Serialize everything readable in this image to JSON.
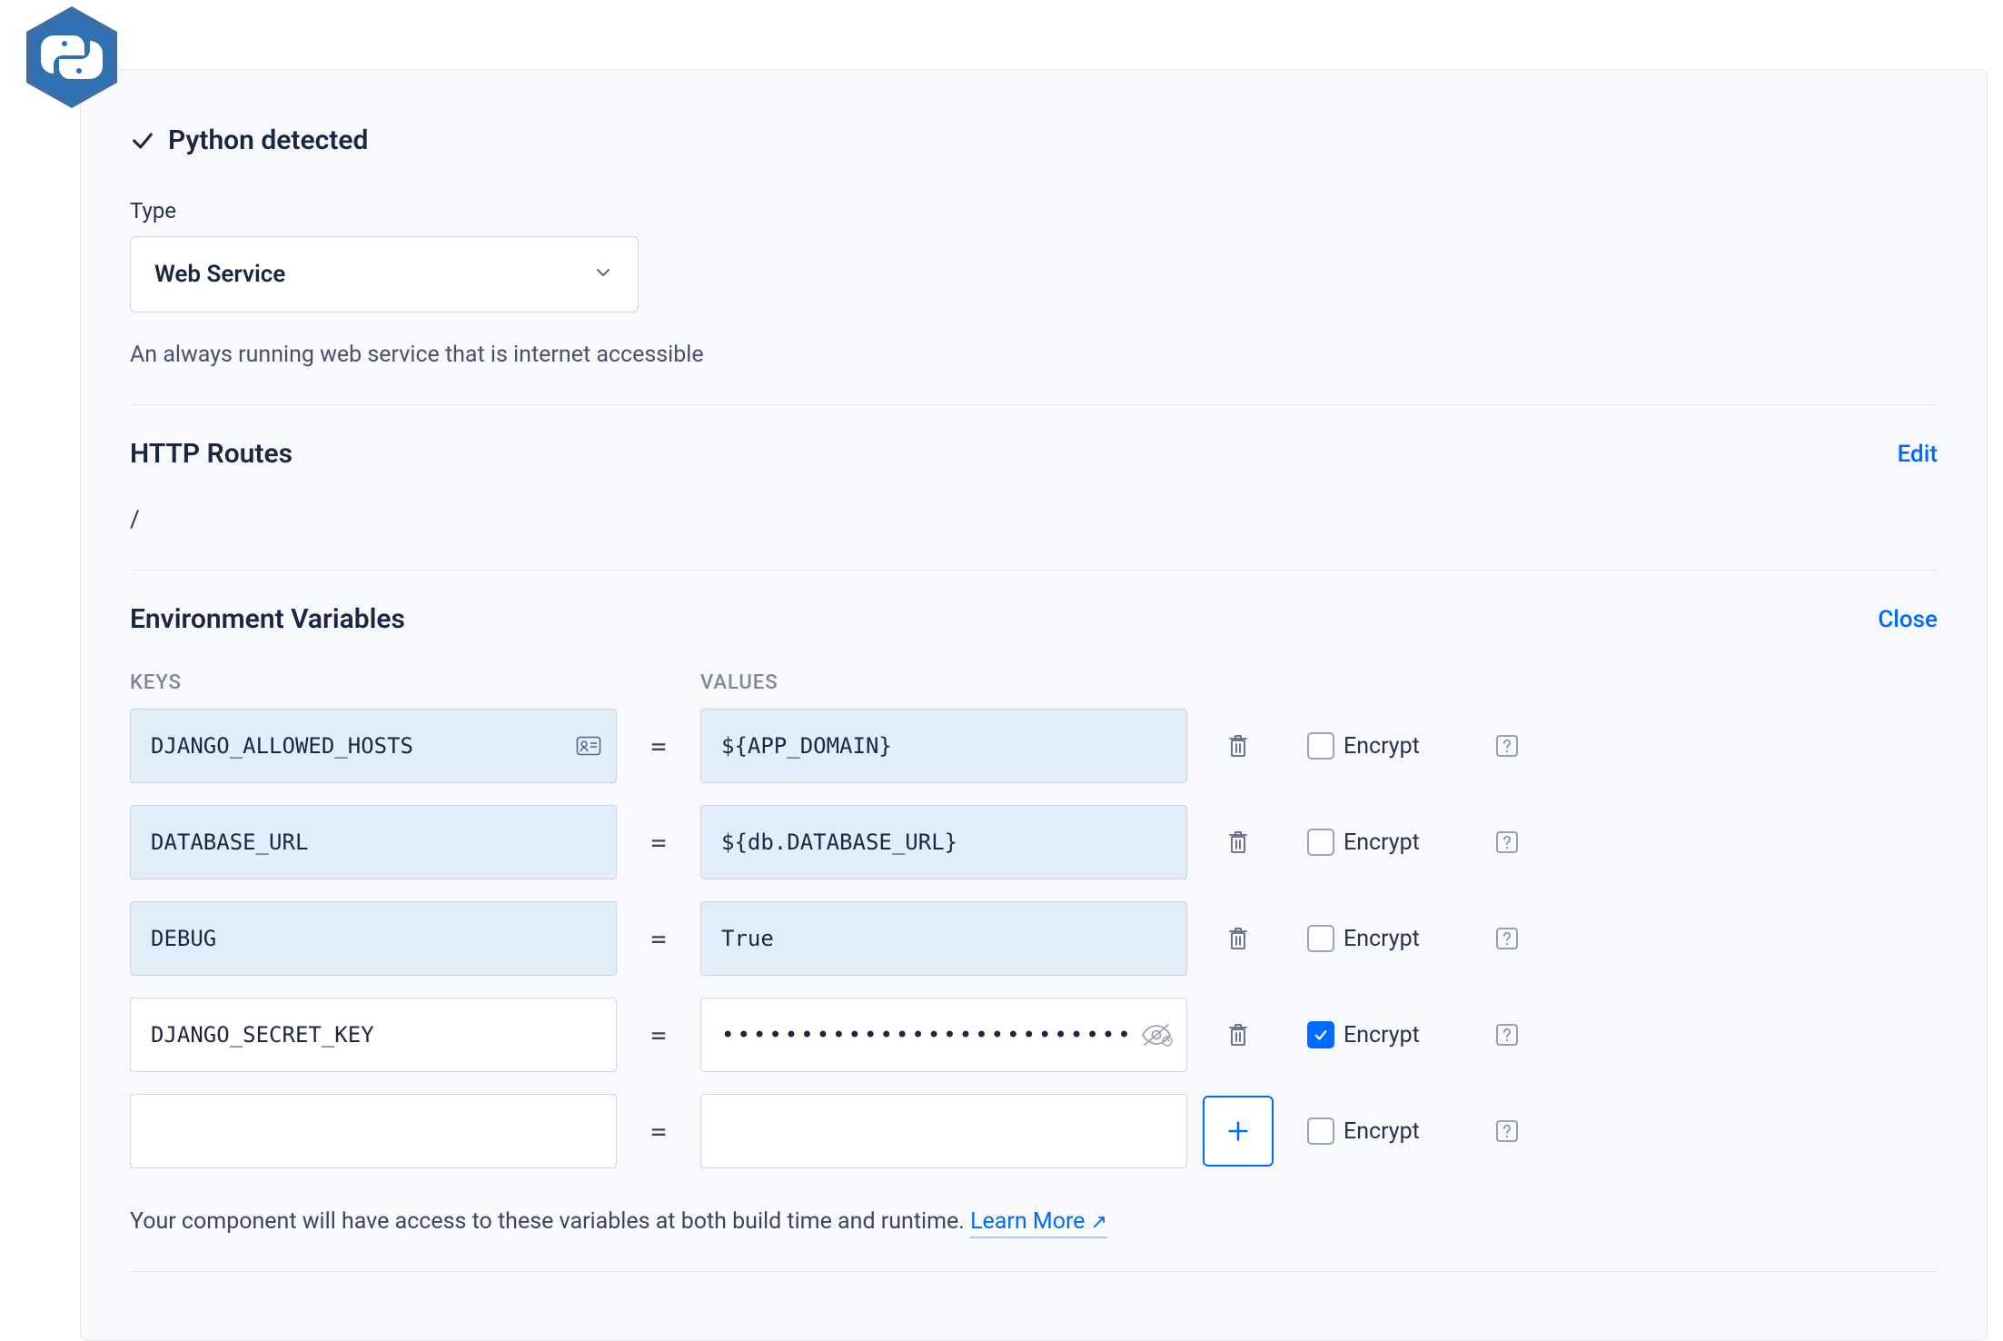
{
  "header": {
    "detected_label": "Python detected",
    "type_label": "Type",
    "type_value": "Web Service",
    "type_description": "An always running web service that is internet accessible"
  },
  "routes": {
    "title": "HTTP Routes",
    "action": "Edit",
    "paths": [
      "/"
    ]
  },
  "env": {
    "title": "Environment Variables",
    "action": "Close",
    "col_keys_label": "KEYS",
    "col_values_label": "VALUES",
    "encrypt_label": "Encrypt",
    "rows": [
      {
        "key": "DJANGO_ALLOWED_HOSTS",
        "value": "${APP_DOMAIN}",
        "encrypted": false,
        "key_icon": true,
        "masked": false,
        "filled_bg": true
      },
      {
        "key": "DATABASE_URL",
        "value": "${db.DATABASE_URL}",
        "encrypted": false,
        "key_icon": false,
        "masked": false,
        "filled_bg": true
      },
      {
        "key": "DEBUG",
        "value": "True",
        "encrypted": false,
        "key_icon": false,
        "masked": false,
        "filled_bg": true
      },
      {
        "key": "DJANGO_SECRET_KEY",
        "value": "••••••••••••••••••••••••••",
        "encrypted": true,
        "key_icon": false,
        "masked": true,
        "filled_bg": false
      },
      {
        "key": "",
        "value": "",
        "encrypted": false,
        "key_icon": false,
        "masked": false,
        "filled_bg": false,
        "is_new": true
      }
    ],
    "footer_note": "Your component will have access to these variables at both build time and runtime.",
    "learn_more_label": "Learn More"
  }
}
